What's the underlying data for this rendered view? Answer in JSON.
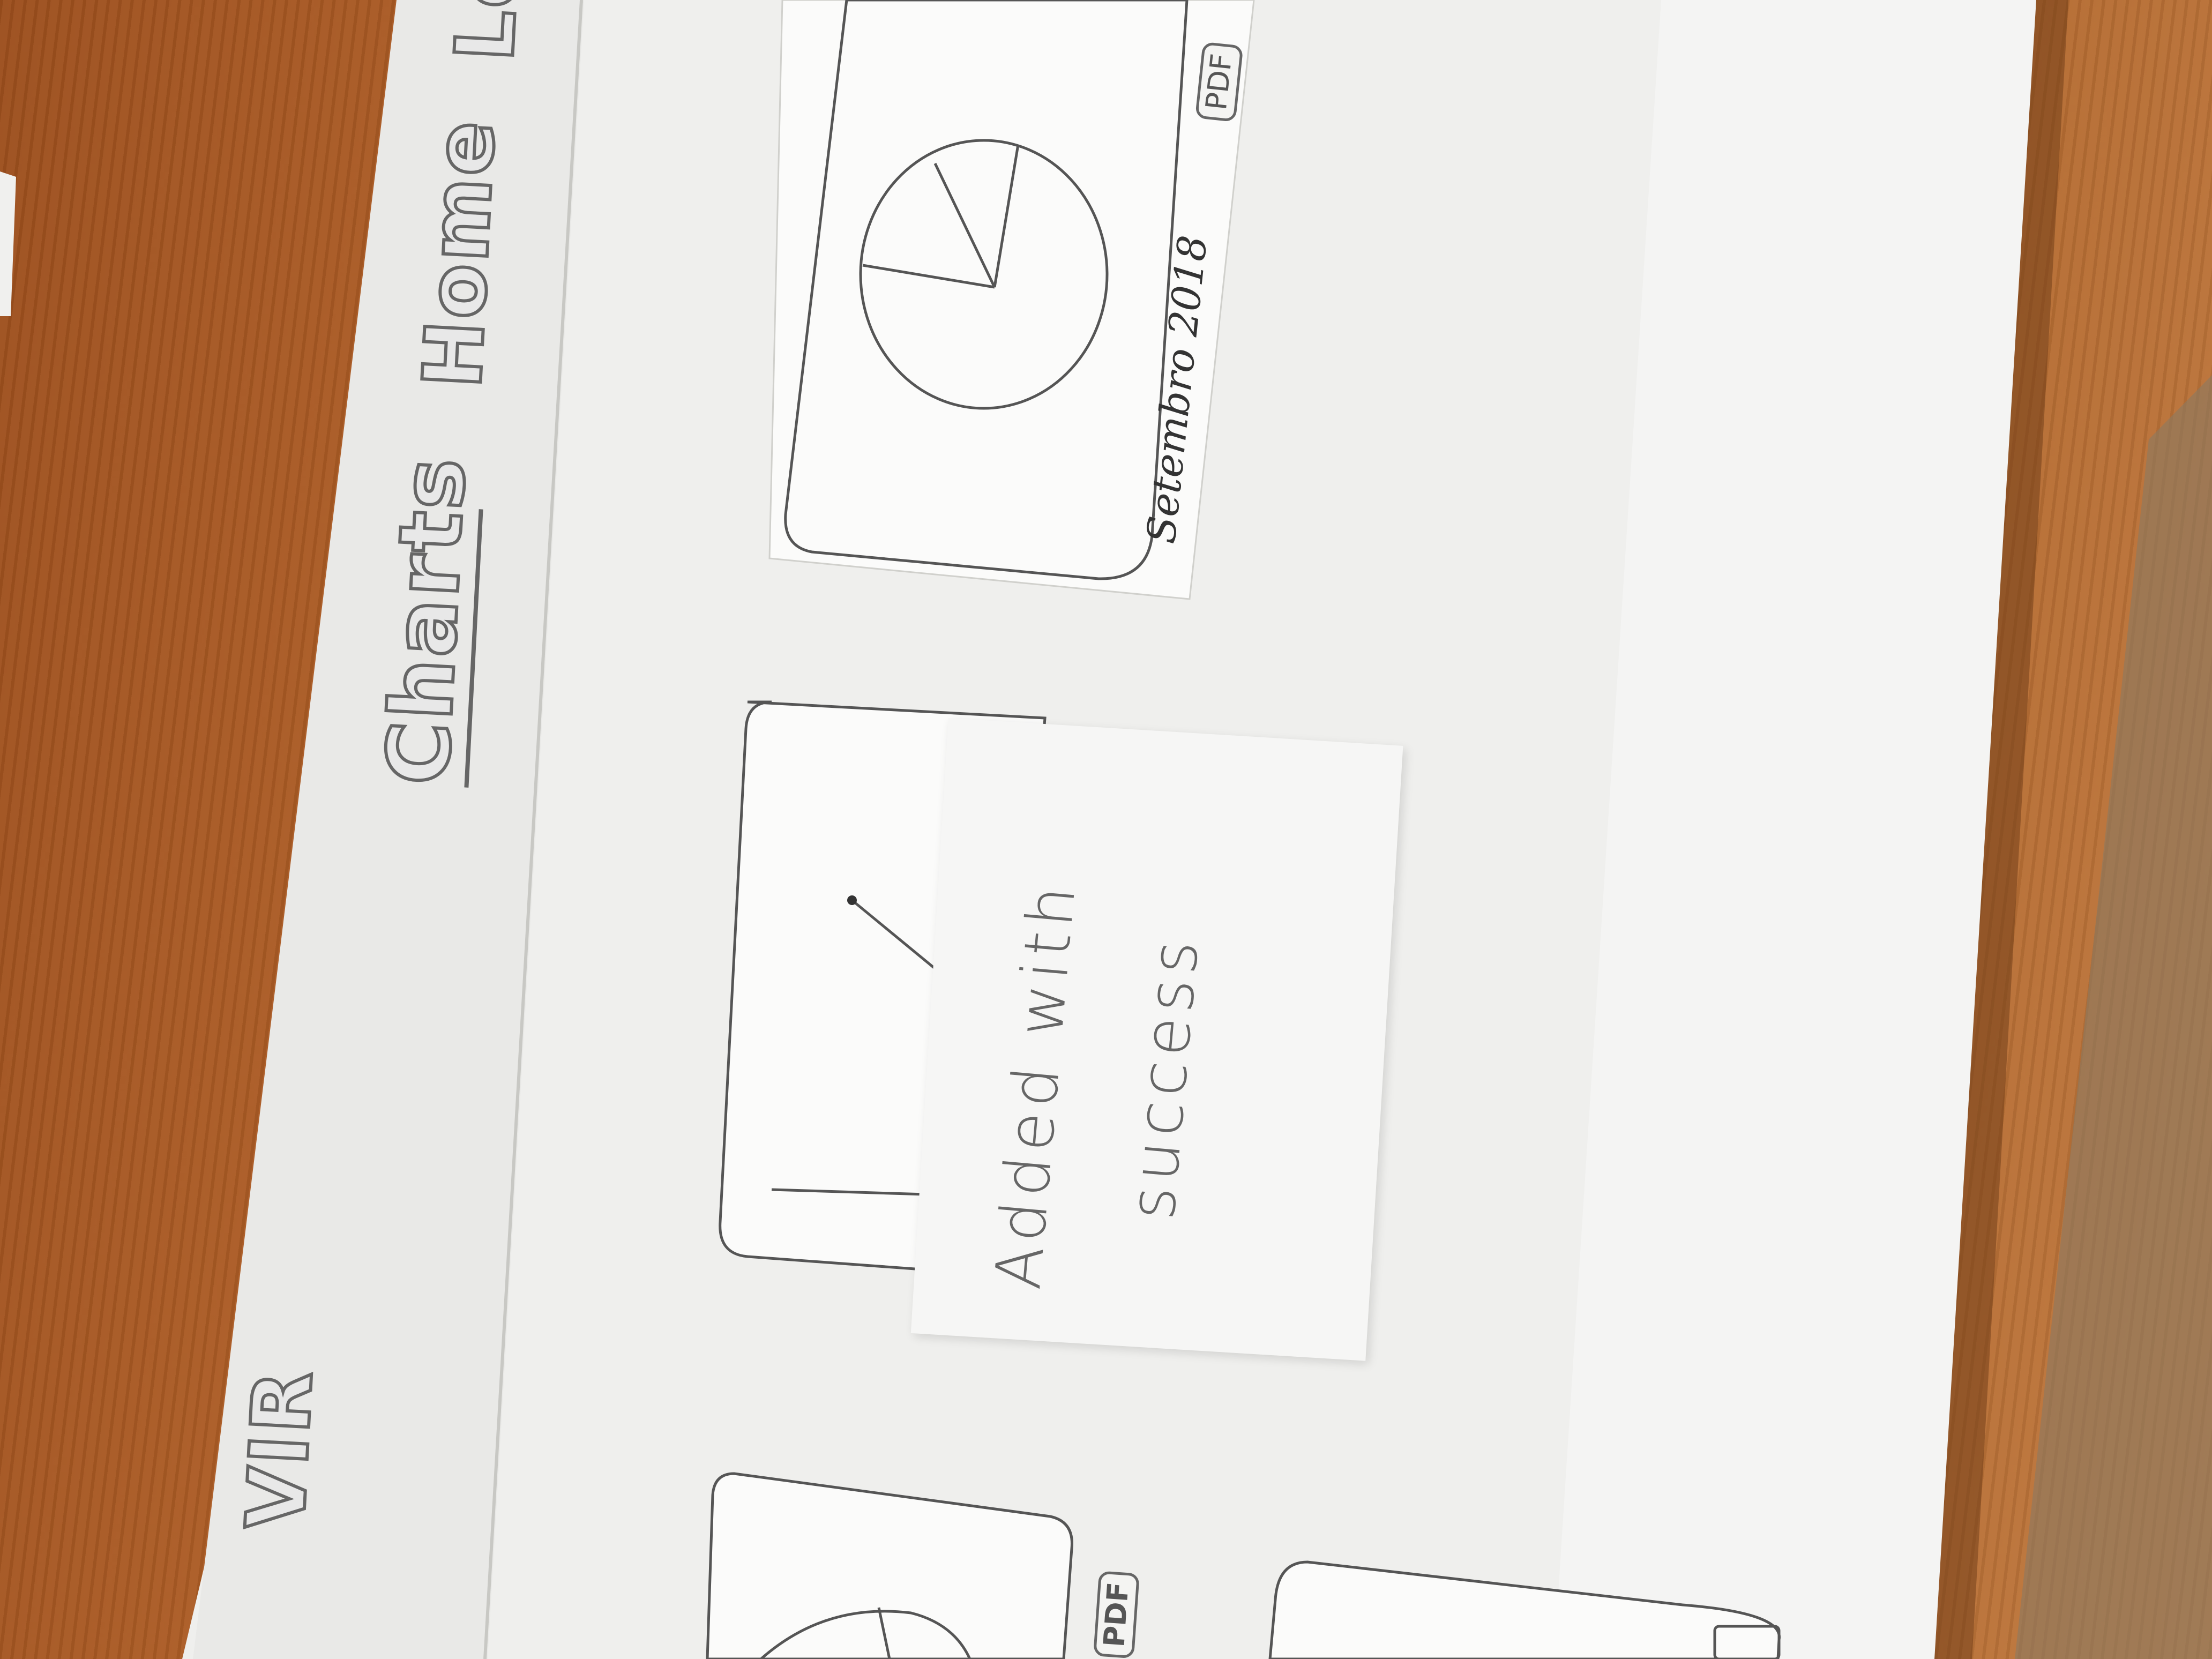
{
  "navigation": {
    "brand_partial": "VIR",
    "items": [
      {
        "label": "Charts",
        "active": true
      },
      {
        "label": "Home",
        "active": false
      },
      {
        "label": "Lo",
        "active": false
      }
    ]
  },
  "cards": [
    {
      "chart_icon": "pie-chart-icon",
      "caption": "Setembro 2018",
      "action_label": "PDF"
    },
    {
      "chart_icon": "line-chart-icon",
      "caption": "",
      "action_label": ""
    },
    {
      "chart_icon": "pie-chart-icon",
      "caption": "",
      "action_label": "PDF"
    }
  ],
  "toast": {
    "message_line1": "Added with",
    "message_line2": "success"
  },
  "colors": {
    "table_wood": "#b05d24",
    "paper": "#f2f2f0",
    "pencil": "#555555"
  }
}
